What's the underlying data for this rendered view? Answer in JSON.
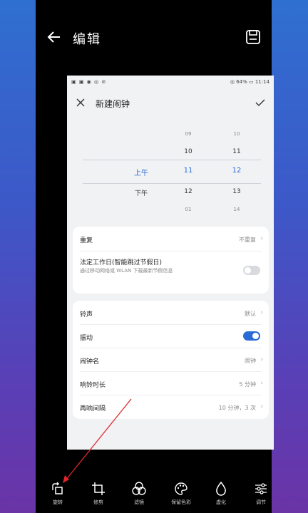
{
  "editor": {
    "title": "编辑",
    "back_icon": "back-arrow-icon",
    "save_icon": "save-icon"
  },
  "phone": {
    "status_left": "▣ ▣ ◉ ◎ ⊘",
    "status_right": "◎ 64% ▭ 11:14",
    "app_title": "新建闹钟",
    "picker": {
      "ampm": [
        "上午",
        "下午"
      ],
      "hours": [
        "09",
        "10",
        "11",
        "12",
        "01"
      ],
      "minutes": [
        "10",
        "11",
        "12",
        "13",
        "14"
      ]
    },
    "card1": {
      "repeat_label": "重复",
      "repeat_value": "不重复",
      "workday_label": "法定工作日(智能跳过节假日)",
      "workday_sub": "通过移动网络或 WLAN 下载最新节假信息"
    },
    "card2": {
      "ringtone_label": "铃声",
      "ringtone_value": "默认",
      "vibrate_label": "振动",
      "name_label": "闹钟名",
      "name_value": "闹钟",
      "duration_label": "响铃时长",
      "duration_value": "5 分钟",
      "interval_label": "再响间隔",
      "interval_value": "10 分钟，3 次"
    }
  },
  "toolbar": {
    "items": [
      {
        "label": "旋转",
        "icon": "rotate-icon"
      },
      {
        "label": "修剪",
        "icon": "crop-icon"
      },
      {
        "label": "滤镜",
        "icon": "filter-icon"
      },
      {
        "label": "保留色彩",
        "icon": "palette-icon"
      },
      {
        "label": "虚化",
        "icon": "blur-drop-icon"
      },
      {
        "label": "调节",
        "icon": "adjust-sliders-icon"
      }
    ]
  },
  "colors": {
    "accent": "#2a6ad6",
    "annotation_arrow": "#e0262b"
  }
}
